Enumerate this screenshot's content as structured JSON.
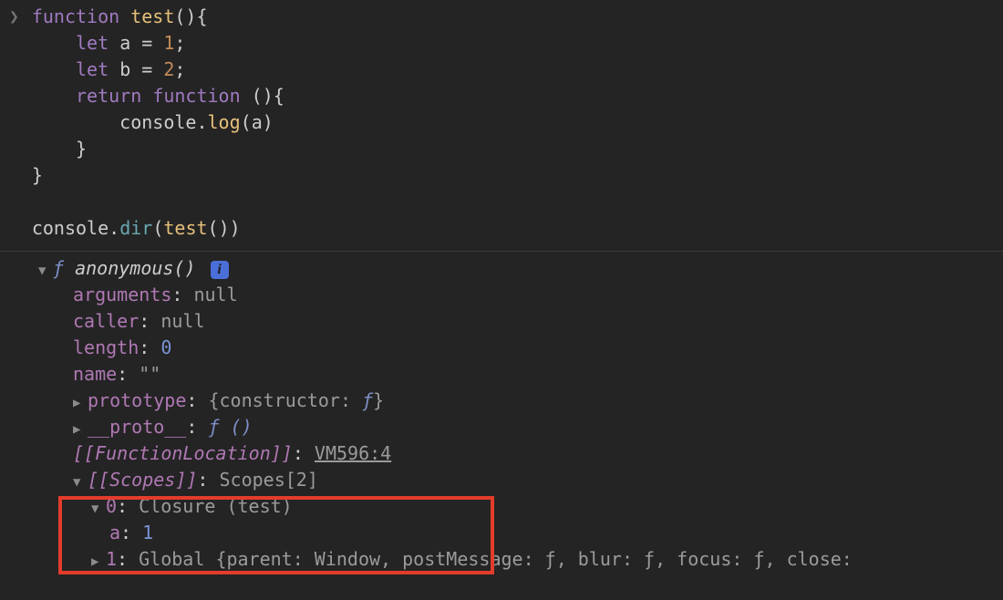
{
  "code": {
    "line1": {
      "kw": "function",
      "name": "test",
      "paren": "(){"
    },
    "line2": {
      "kw": "let",
      "id": "a",
      "eq": " = ",
      "val": "1",
      "semi": ";"
    },
    "line3": {
      "kw": "let",
      "id": "b",
      "eq": " = ",
      "val": "2",
      "semi": ";"
    },
    "line4": {
      "kw1": "return",
      "kw2": "function",
      "paren": " (){"
    },
    "line5": {
      "obj": "console",
      "dot": ".",
      "fn": "log",
      "open": "(",
      "arg": "a",
      "close": ")"
    },
    "line6": "    }",
    "line7": "}",
    "line8": {
      "obj": "console",
      "dot": ".",
      "fn": "dir",
      "open": "(",
      "call": "test",
      "close": "())"
    }
  },
  "out": {
    "header": {
      "f": "ƒ ",
      "name": "anonymous()"
    },
    "arguments": {
      "k": "arguments",
      "v": "null"
    },
    "caller": {
      "k": "caller",
      "v": "null"
    },
    "length": {
      "k": "length",
      "v": "0"
    },
    "name": {
      "k": "name",
      "v": "\"\""
    },
    "prototype": {
      "k": "prototype",
      "brace1": "{",
      "ck": "constructor",
      "cv": "ƒ",
      "brace2": "}"
    },
    "proto": {
      "k": "__proto__",
      "v": "ƒ ()"
    },
    "funclocation": {
      "k": "[[FunctionLocation]]",
      "v": "VM596:4"
    },
    "scopes": {
      "k": "[[Scopes]]",
      "v": "Scopes[2]"
    },
    "scope0": {
      "idx": "0",
      "label": "Closure (test)"
    },
    "scope0_a": {
      "k": "a",
      "v": "1"
    },
    "scope1": {
      "idx": "1",
      "label": "Global ",
      "preview": "{parent: Window, postMessage: ƒ, blur: ƒ, focus: ƒ, close:"
    }
  },
  "colon": ": "
}
